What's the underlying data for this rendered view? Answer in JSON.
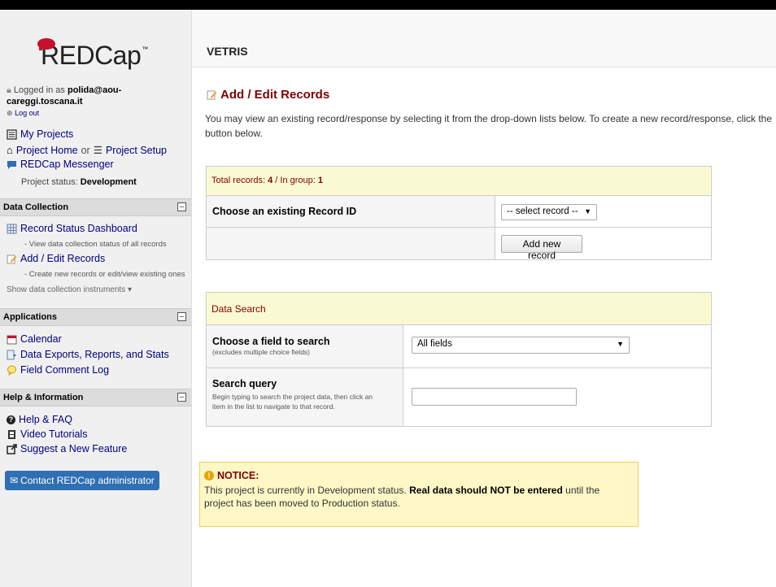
{
  "sidebar": {
    "logo_text": "REDCap",
    "logo_tm": "™",
    "logged_in_prefix": "Logged in as",
    "user_line1": "polida@aou-",
    "user_line2": "careggi.toscana.it",
    "logout": "Log out",
    "my_projects": "My Projects",
    "project_home": "Project Home",
    "or": "or",
    "project_setup": "Project Setup",
    "messenger": "REDCap Messenger",
    "project_status_label": "Project status:",
    "project_status_value": "Development",
    "data_collection": {
      "title": "Data Collection",
      "record_status_dashboard": "Record Status Dashboard",
      "record_status_sub": "- View data collection status of all records",
      "add_edit": "Add / Edit Records",
      "add_edit_sub": "- Create new records or edit/view existing ones",
      "show_instruments": "Show data collection instruments"
    },
    "applications": {
      "title": "Applications",
      "calendar": "Calendar",
      "data_exports": "Data Exports, Reports, and Stats",
      "field_comment_log": "Field Comment Log"
    },
    "help": {
      "title": "Help & Information",
      "faq": "Help & FAQ",
      "video": "Video Tutorials",
      "suggest": "Suggest a New Feature"
    },
    "contact_button": "Contact REDCap administrator"
  },
  "header": {
    "project_title": "VETRIS"
  },
  "main": {
    "page_title": "Add / Edit Records",
    "intro_line1": "You may view an existing record/response by selecting it from the drop-down lists below. To create a new record/response, click the",
    "intro_line2": "button below.",
    "records_table": {
      "total_label": "Total records:",
      "total_value": "4",
      "group_label": "In group:",
      "group_value": "1",
      "choose_label": "Choose an existing Record ID",
      "select_value": "-- select record --",
      "add_button": "Add new record"
    },
    "search_table": {
      "title": "Data Search",
      "field_label": "Choose a field to search",
      "field_sub": "(excludes multiple choice fields)",
      "field_value": "All fields",
      "query_label": "Search query",
      "query_sub1": "Begin typing to search the project data, then click an",
      "query_sub2": "item in the list to navigate to that record.",
      "query_value": ""
    },
    "notice": {
      "title": "NOTICE:",
      "text1": "This project is currently in Development status.",
      "bold": "Real data should NOT be entered",
      "text2": "until the",
      "text3": "project has been moved to Production status."
    }
  },
  "colors": {
    "accent": "#800000",
    "link": "#000080",
    "contact_bg": "#2f6fb3",
    "notice_bg": "#fff7c6"
  }
}
